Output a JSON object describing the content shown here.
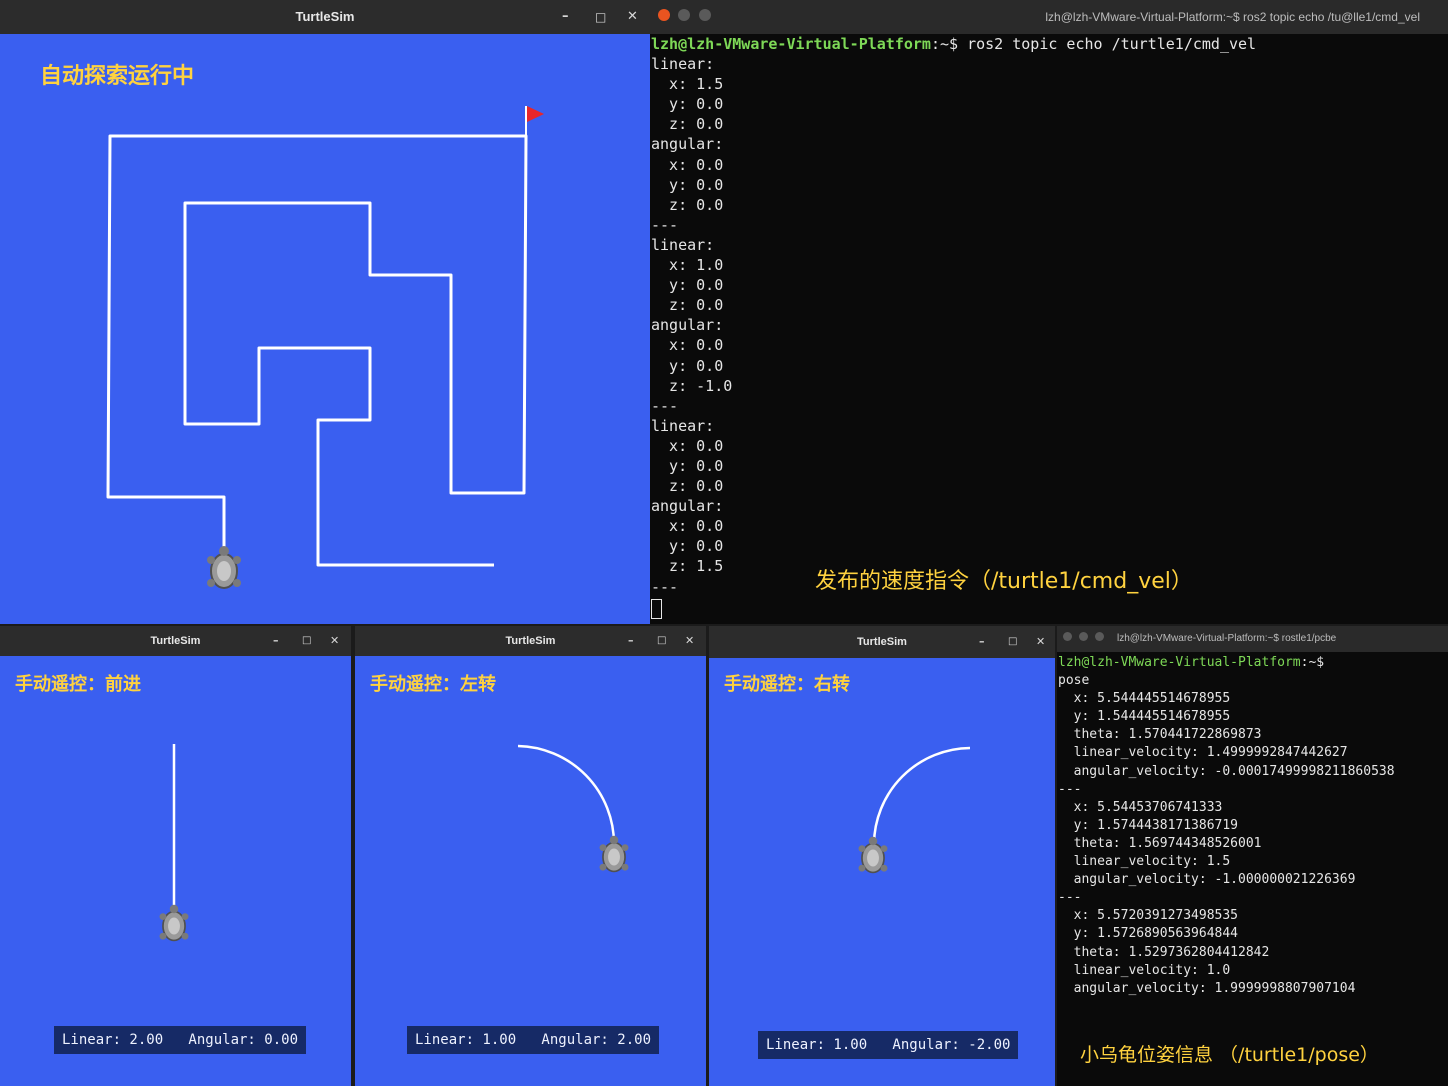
{
  "main_window": {
    "title": "TurtleSim",
    "annotation": "自动探索运行中",
    "controls": {
      "minimize": "–",
      "maximize": "□",
      "close": "✕"
    }
  },
  "echo_terminal": {
    "title": "lzh@lzh-VMware-Virtual-Platform:~$ ros2 topic echo /tu@lle1/cmd_vel",
    "prompt_user": "lzh@lzh-VMware-Virtual-Platform",
    "prompt_path": ":~$ ",
    "command": "ros2 topic echo /turtle1/cmd_vel",
    "lines": [
      "linear:",
      "  x: 1.5",
      "  y: 0.0",
      "  z: 0.0",
      "angular:",
      "  x: 0.0",
      "  y: 0.0",
      "  z: 0.0",
      "---",
      "linear:",
      "  x: 1.0",
      "  y: 0.0",
      "  z: 0.0",
      "angular:",
      "  x: 0.0",
      "  y: 0.0",
      "  z: -1.0",
      "---",
      "linear:",
      "  x: 0.0",
      "  y: 0.0",
      "  z: 0.0",
      "angular:",
      "  x: 0.0",
      "  y: 0.0",
      "  z: 1.5",
      "---"
    ],
    "annotation": "发布的速度指令（/turtle1/cmd_vel）"
  },
  "forward_window": {
    "title": "TurtleSim",
    "annotation": "手动遥控：前进",
    "readout": "Linear: 2.00   Angular: 0.00",
    "linear": 2.0,
    "angular": 0.0
  },
  "left_window": {
    "title": "TurtleSim",
    "annotation": "手动遥控：左转",
    "readout": "Linear: 1.00   Angular: 2.00",
    "linear": 1.0,
    "angular": 2.0
  },
  "right_window": {
    "title": "TurtleSim",
    "annotation": "手动遥控：右转",
    "readout": "Linear: 1.00   Angular: -2.00",
    "linear": 1.0,
    "angular": -2.0
  },
  "pose_terminal": {
    "title": "lzh@lzh-VMware-Virtual-Platform:~$ rostle1/pcbe",
    "prompt_user": "lzh@lzh-VMware-Virtual-Platform",
    "prompt_path": ":~$",
    "lines": [
      "pose",
      "  x: 5.544445514678955",
      "  y: 1.544445514678955",
      "  theta: 1.570441722869873",
      "  linear_velocity: 1.4999992847442627",
      "  angular_velocity: -0.0001749999821186053‌8",
      "---",
      "  x: 5.54453706741333",
      "  y: 1.5744438171386719",
      "  theta: 1.569744348526001",
      "  linear_velocity: 1.5",
      "  angular_velocity: -1.000000021226369",
      "---",
      "  x: 5.5720391273498535",
      "  y: 1.5726890563964844",
      "  theta: 1.5297362804412842",
      "  linear_velocity: 1.0",
      "  angular_velocity: 1.9999998807907104"
    ],
    "annotation": "小乌龟位姿信息 （/turtle1/pose）"
  },
  "colors": {
    "canvas_blue": "#3a5ff0",
    "annotation_yellow": "#ffd23f",
    "prompt_green": "#7ed957",
    "flag_red": "#e8262a",
    "terminal_bg": "#0a0a0a"
  }
}
